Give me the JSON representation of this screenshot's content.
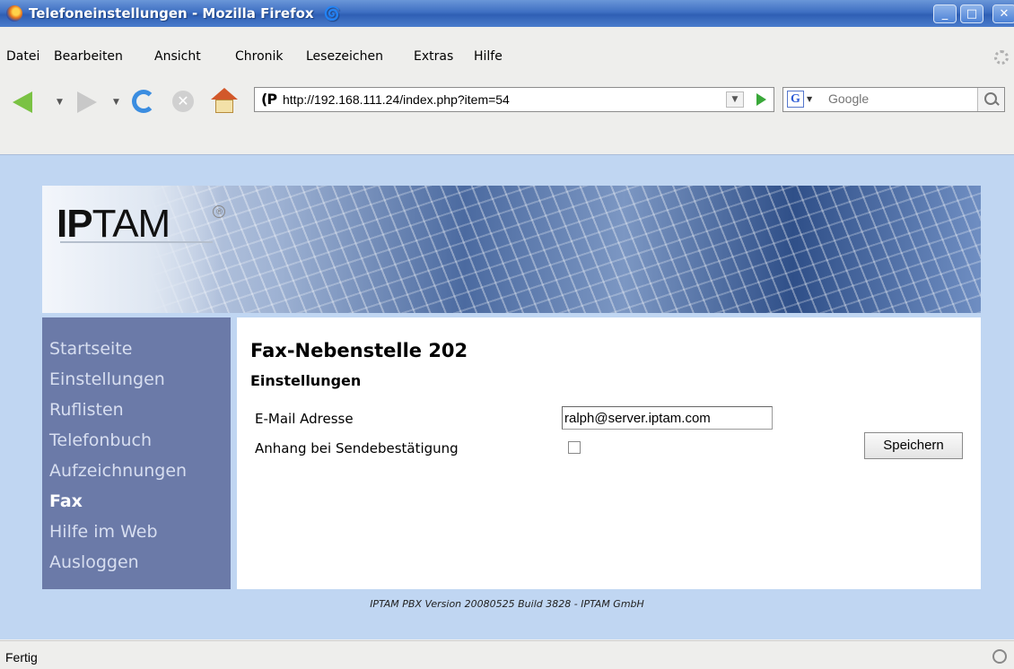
{
  "window": {
    "title": "Telefoneinstellungen - Mozilla Firefox"
  },
  "menu": [
    {
      "label": "Datei"
    },
    {
      "label": "Bearbeiten"
    },
    {
      "label": "Ansicht"
    },
    {
      "label": "Chronik"
    },
    {
      "label": "Lesezeichen"
    },
    {
      "label": "Extras"
    },
    {
      "label": "Hilfe"
    }
  ],
  "toolbar": {
    "url": "http://192.168.111.24/index.php?item=54",
    "search_placeholder": "Google"
  },
  "banner": {
    "logo_bold": "IP",
    "logo_rest": "TAM"
  },
  "sidebar": {
    "items": [
      {
        "label": "Startseite"
      },
      {
        "label": "Einstellungen"
      },
      {
        "label": "Ruflisten"
      },
      {
        "label": "Telefonbuch"
      },
      {
        "label": "Aufzeichnungen"
      },
      {
        "label": "Fax"
      },
      {
        "label": "Hilfe im Web"
      },
      {
        "label": "Ausloggen"
      }
    ],
    "active": "Fax"
  },
  "main": {
    "title": "Fax-Nebenstelle 202",
    "section": "Einstellungen",
    "email_label": "E-Mail Adresse",
    "email_value": "ralph@server.iptam.com",
    "attachment_label": "Anhang bei Sendebestätigung",
    "attachment_checked": false,
    "save_label": "Speichern"
  },
  "footer": "IPTAM PBX Version 20080525 Build 3828 - IPTAM GmbH",
  "status": "Fertig"
}
